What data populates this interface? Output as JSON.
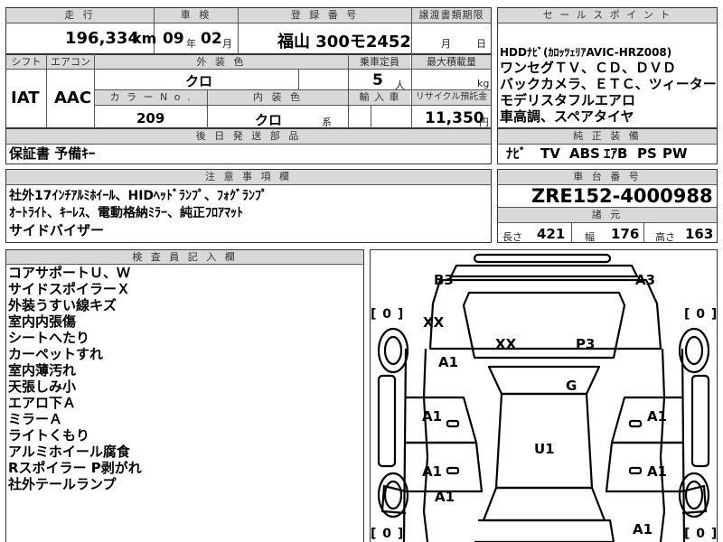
{
  "top": {
    "headers": {
      "mileage": "走 行",
      "inspection": "車 検",
      "registration": "登 録 番 号",
      "transfer_deadline": "譲渡書類期限",
      "sales_points": "セ ー ル ス ポ イ ン ト"
    },
    "mileage_value": "196,334",
    "mileage_unit": "km",
    "inspection_year": "09",
    "inspection_year_unit": "年",
    "inspection_month": "02",
    "inspection_month_unit": "月",
    "registration_value": "福山 300モ2452",
    "transfer_month_unit": "月",
    "transfer_day_unit": "日"
  },
  "row2": {
    "headers": {
      "shift": "シフト",
      "aircon": "エアコン",
      "exterior_color": "外 装 色",
      "capacity": "乗車定員",
      "max_load": "最大積載量",
      "color_no": "カ ラ ー N o .",
      "interior_color": "内 装 色",
      "import": "輸 入 車",
      "recycle": "リサイクル預託金"
    },
    "shift_value": "IAT",
    "aircon_value": "AAC",
    "exterior_color_value": "クロ",
    "capacity_value": "5",
    "capacity_unit": "人",
    "max_load_unit": "kg",
    "color_no_value": "209",
    "interior_color_value": "クロ",
    "interior_color_unit": "系",
    "recycle_value": "11,350",
    "recycle_unit": "円"
  },
  "sales_points": [
    "HDDﾅﾋﾞ(ｶﾛｯﾂｪﾘｱAVIC-HRZ008)",
    "ワンセグＴＶ、ＣＤ、ＤＶＤ",
    "バックカメラ、ＥＴＣ、ツィーター",
    "モデリスタフルエアロ",
    "車高調、スペアタイヤ"
  ],
  "later_parts": {
    "header": "後 日 発 送 部 品",
    "value": "保証書 予備ｷｰ"
  },
  "equipment": {
    "header": "純 正 装 備",
    "items": [
      "ﾅﾋﾞ",
      "TV",
      "ABS",
      "ｴｱB",
      "PS",
      "PW"
    ]
  },
  "notes": {
    "header": "注 意 事 項 欄",
    "lines": [
      "社外17ｲﾝﾁｱﾙﾐﾎｲｰﾙ、HIDﾍｯﾄﾞﾗﾝﾌﾟ、ﾌｫｸﾞﾗﾝﾌﾟ",
      "ｵｰﾄﾗｲﾄ、ｷｰﾚｽ、電動格納ﾐﾗｰ、純正ﾌﾛｱﾏｯﾄ",
      "サイドバイザー"
    ]
  },
  "chassis": {
    "header": "車 台 番 号",
    "value": "ZRE152-4000988"
  },
  "specs": {
    "header": "諸 元",
    "length_label": "長さ",
    "length_value": "421",
    "width_label": "幅",
    "width_value": "176",
    "height_label": "高さ",
    "height_value": "163"
  },
  "inspector": {
    "header": "検 査 員 記 入 欄",
    "lines": [
      "コアサポートＵ、Ｗ",
      "サイドスポイラーＸ",
      "外装うすい線キズ",
      "室内内張傷",
      "シートへたり",
      "カーペットすれ",
      "室内薄汚れ",
      "天張しみ小",
      "エアロ下Ａ",
      "ミラーＡ",
      "ライトくもり",
      "アルミホイール腐食",
      "Rスポイラー P剥がれ",
      "社外テールランプ"
    ]
  },
  "diagram": {
    "tire_left_top": "[ 0 ]",
    "tire_right_top": "[ 0 ]",
    "tire_left_bottom": "[ 0 ]",
    "tire_right_bottom": "[ 0 ]",
    "marks": {
      "b3": "B3",
      "a3": "A3",
      "xx_left": "XX",
      "xx_center": "XX",
      "p3": "P3",
      "a1_left_fender": "A1",
      "g": "G",
      "a1_left_front_door": "A1",
      "a1_right_front_door": "A1",
      "u1": "U1",
      "a1_left_rear_door": "A1",
      "a1_right_rear_door": "A1",
      "a1_left_rear": "A1",
      "a1_right_rear": "A1"
    }
  }
}
